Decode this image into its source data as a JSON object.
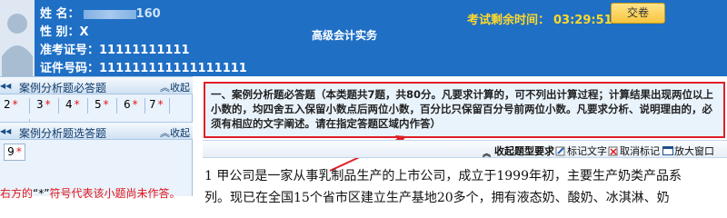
{
  "candidate": {
    "name_label": "姓 名：",
    "name_partial": "160",
    "gender_label": "性 别：",
    "gender_value": "X",
    "ticket_label": "准考证号：",
    "ticket_value": "11111111111",
    "id_label": "证件号码：",
    "id_value": "111111111111111111"
  },
  "exam": {
    "title": "高级会计实务",
    "timer_label": "考试剩余时间：",
    "timer_value": "03:29:51",
    "submit_label": "交卷"
  },
  "left_panel": {
    "section1": {
      "title": "案例分析题必答题",
      "collapse_label": "收起",
      "questions": [
        {
          "num": "2",
          "marked": "*"
        },
        {
          "num": "3",
          "marked": "*"
        },
        {
          "num": "4",
          "marked": "*"
        },
        {
          "num": "5",
          "marked": "*"
        },
        {
          "num": "6",
          "marked": "*"
        },
        {
          "num": "7",
          "marked": "*"
        }
      ]
    },
    "section2": {
      "title": "案例分析题选答题",
      "collapse_label": "收起",
      "questions": [
        {
          "num": "9",
          "marked": "*"
        }
      ]
    },
    "legend": {
      "prefix": "右方的",
      "quote": "“*”",
      "suffix": "符号代表该小题尚未作答。"
    }
  },
  "question": {
    "instructions": "一、案例分析题必答题（本类题共7题，共80分。凡要求计算的，可不列出计算过程；计算结果出现两位以上小数的，均四舍五入保留小数点后两位小数，百分比只保留百分号前两位小数。凡要求分析、说明理由的，必须有相应的文字阐述。请在指定答题区域内作答）",
    "toolbar": {
      "collapse_label": "收起题型要求",
      "mark_label": "标记文字",
      "unmark_label": "取消标记",
      "zoom_label": "放大窗口"
    },
    "line1": "1  甲公司是一家从事乳制品生产的上市公司，成立于1999年初，主要生产奶类产品系",
    "line2": "列。现已在全国15个省市区建立生产基地20多个，拥有液态奶、酸奶、冰淇淋、奶"
  },
  "colors": {
    "header_bg": "#1f6fc5",
    "timer": "#ffd92a",
    "marker_red": "#e0151c",
    "instruction_border": "#e01f26",
    "instruction_bg": "#e9f3fc",
    "panel_bg": "#eaf2fb"
  }
}
